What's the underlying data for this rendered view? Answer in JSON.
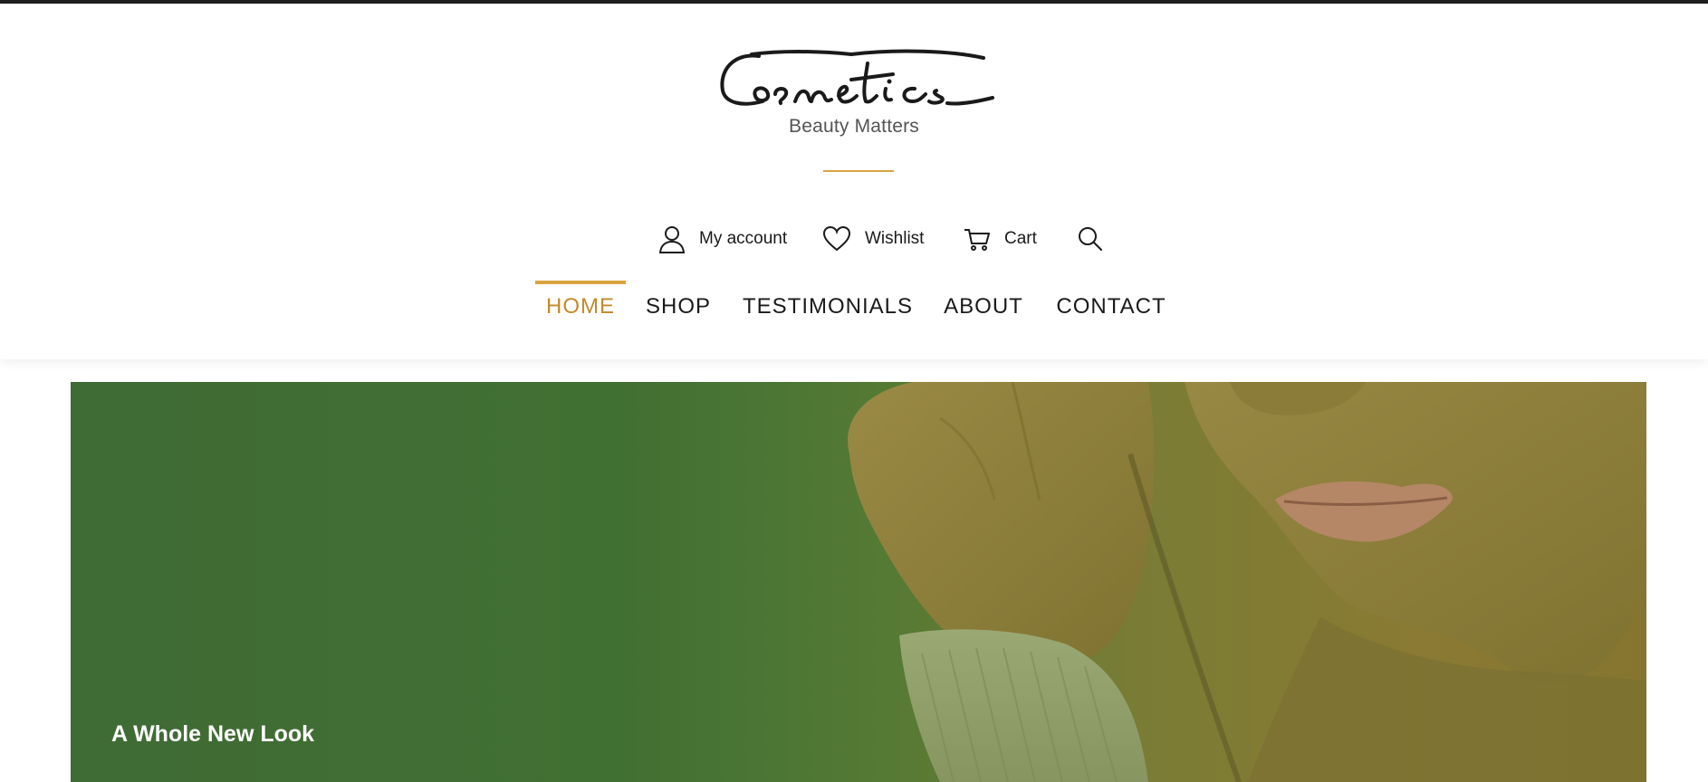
{
  "brand": {
    "logo_text": "Cosmetics",
    "tagline": "Beauty Matters",
    "accent_color": "#d9a441"
  },
  "utility": [
    {
      "label": "My account",
      "icon": "user-icon"
    },
    {
      "label": "Wishlist",
      "icon": "heart-icon"
    },
    {
      "label": "Cart",
      "icon": "cart-icon"
    },
    {
      "label": "",
      "icon": "search-icon"
    }
  ],
  "nav": {
    "active": "HOME",
    "items": [
      {
        "label": "HOME"
      },
      {
        "label": "SHOP"
      },
      {
        "label": "TESTIMONIALS"
      },
      {
        "label": "ABOUT"
      },
      {
        "label": "CONTACT"
      }
    ]
  },
  "hero": {
    "title": "A Whole New Look",
    "overlay_color": "#417033"
  }
}
